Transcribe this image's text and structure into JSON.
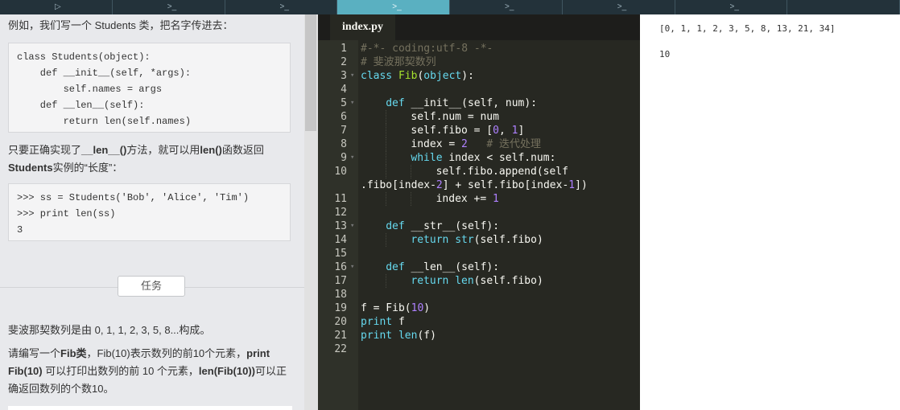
{
  "top_tabs": [
    {
      "glyph": "▷",
      "active": false
    },
    {
      "glyph": ">_",
      "active": false
    },
    {
      "glyph": ">_",
      "active": false
    },
    {
      "glyph": ">_",
      "active": true
    },
    {
      "glyph": ">_",
      "active": false
    },
    {
      "glyph": ">_",
      "active": false
    },
    {
      "glyph": ">_",
      "active": false
    },
    {
      "glyph": "",
      "active": false
    }
  ],
  "lesson": {
    "intro": "例如，我们写一个 Students 类，把名字传进去：",
    "code1": "class Students(object):\n    def __init__(self, *args):\n        self.names = args\n    def __len__(self):\n        return len(self.names)",
    "para2_pre": "只要正确实现了",
    "para2_b1": "__len__()",
    "para2_mid1": "方法，就可以用",
    "para2_b2": "len()",
    "para2_mid2": "函数返回",
    "para2_b3": "Students",
    "para2_post": "实例的“长度”：",
    "code2": ">>> ss = Students('Bob', 'Alice', 'Tim')\n>>> print len(ss)\n3",
    "task_button": "任务",
    "task_para1": "斐波那契数列是由 0, 1, 1, 2, 3, 5, 8...构成。",
    "task_p2_pre": "请编写一个",
    "task_p2_b1": "Fib类",
    "task_p2_mid1": "，Fib(10)表示数列的前10个元素，",
    "task_p2_b2": "print Fib(10)",
    "task_p2_mid2": " 可以打印出数列的前 10 个元素，",
    "task_p2_b3": "len(Fib(10))",
    "task_p2_post": "可以正确返回数列的个数10。"
  },
  "editor": {
    "filename": "index.py",
    "lines": [
      {
        "n": "1",
        "fold": false,
        "indent": 0,
        "parts": [
          [
            "cmt",
            "#-*- coding:utf-8 -*-"
          ]
        ]
      },
      {
        "n": "2",
        "fold": false,
        "indent": 0,
        "parts": [
          [
            "cmt",
            "# 斐波那契数列"
          ]
        ]
      },
      {
        "n": "3",
        "fold": true,
        "indent": 0,
        "parts": [
          [
            "kw",
            "class"
          ],
          [
            "",
            " "
          ],
          [
            "cls",
            "Fib"
          ],
          [
            "",
            "("
          ],
          [
            "kw",
            "object"
          ],
          [
            "",
            "):"
          ]
        ]
      },
      {
        "n": "4",
        "fold": false,
        "indent": 0,
        "parts": []
      },
      {
        "n": "5",
        "fold": true,
        "indent": 1,
        "parts": [
          [
            "kw",
            "def"
          ],
          [
            "",
            " __init__(self, num):"
          ]
        ]
      },
      {
        "n": "6",
        "fold": false,
        "indent": 2,
        "parts": [
          [
            "",
            "self.num = num"
          ]
        ]
      },
      {
        "n": "7",
        "fold": false,
        "indent": 2,
        "parts": [
          [
            "",
            "self.fibo = ["
          ],
          [
            "num",
            "0"
          ],
          [
            "",
            ", "
          ],
          [
            "num",
            "1"
          ],
          [
            "",
            "]"
          ]
        ]
      },
      {
        "n": "8",
        "fold": false,
        "indent": 2,
        "parts": [
          [
            "",
            "index = "
          ],
          [
            "num",
            "2"
          ],
          [
            "",
            "   "
          ],
          [
            "cmt",
            "# 迭代处理"
          ]
        ]
      },
      {
        "n": "9",
        "fold": true,
        "indent": 2,
        "parts": [
          [
            "kw",
            "while"
          ],
          [
            "",
            " index < self.num:"
          ]
        ]
      },
      {
        "n": "10",
        "fold": false,
        "indent": 3,
        "parts": [
          [
            "",
            "self.fibo.append(self"
          ]
        ]
      },
      {
        "n": "",
        "fold": false,
        "indent": 0,
        "parts": [
          [
            "",
            ".fibo[index-"
          ],
          [
            "num",
            "2"
          ],
          [
            "",
            "] + self.fibo[index-"
          ],
          [
            "num",
            "1"
          ],
          [
            "",
            "])"
          ]
        ]
      },
      {
        "n": "11",
        "fold": false,
        "indent": 3,
        "parts": [
          [
            "",
            "index += "
          ],
          [
            "num",
            "1"
          ]
        ]
      },
      {
        "n": "12",
        "fold": false,
        "indent": 0,
        "parts": []
      },
      {
        "n": "13",
        "fold": true,
        "indent": 1,
        "parts": [
          [
            "kw",
            "def"
          ],
          [
            "",
            " __str__(self):"
          ]
        ]
      },
      {
        "n": "14",
        "fold": false,
        "indent": 2,
        "parts": [
          [
            "kw",
            "return"
          ],
          [
            "",
            " "
          ],
          [
            "kw",
            "str"
          ],
          [
            "",
            "(self.fibo)"
          ]
        ]
      },
      {
        "n": "15",
        "fold": false,
        "indent": 0,
        "parts": []
      },
      {
        "n": "16",
        "fold": true,
        "indent": 1,
        "parts": [
          [
            "kw",
            "def"
          ],
          [
            "",
            " __len__(self):"
          ]
        ]
      },
      {
        "n": "17",
        "fold": false,
        "indent": 2,
        "parts": [
          [
            "kw",
            "return"
          ],
          [
            "",
            " "
          ],
          [
            "kw",
            "len"
          ],
          [
            "",
            "(self.fibo)"
          ]
        ]
      },
      {
        "n": "18",
        "fold": false,
        "indent": 0,
        "parts": []
      },
      {
        "n": "19",
        "fold": false,
        "indent": 0,
        "parts": [
          [
            "",
            "f = Fib("
          ],
          [
            "num",
            "10"
          ],
          [
            "",
            ")"
          ]
        ]
      },
      {
        "n": "20",
        "fold": false,
        "indent": 0,
        "parts": [
          [
            "kw",
            "print"
          ],
          [
            "",
            " f"
          ]
        ]
      },
      {
        "n": "21",
        "fold": false,
        "indent": 0,
        "parts": [
          [
            "kw",
            "print"
          ],
          [
            "",
            " "
          ],
          [
            "kw",
            "len"
          ],
          [
            "",
            "(f)"
          ]
        ]
      },
      {
        "n": "22",
        "fold": false,
        "indent": 0,
        "parts": []
      }
    ]
  },
  "output": {
    "lines": [
      "[0, 1, 1, 2, 3, 5, 8, 13, 21, 34]",
      "",
      "10"
    ]
  }
}
